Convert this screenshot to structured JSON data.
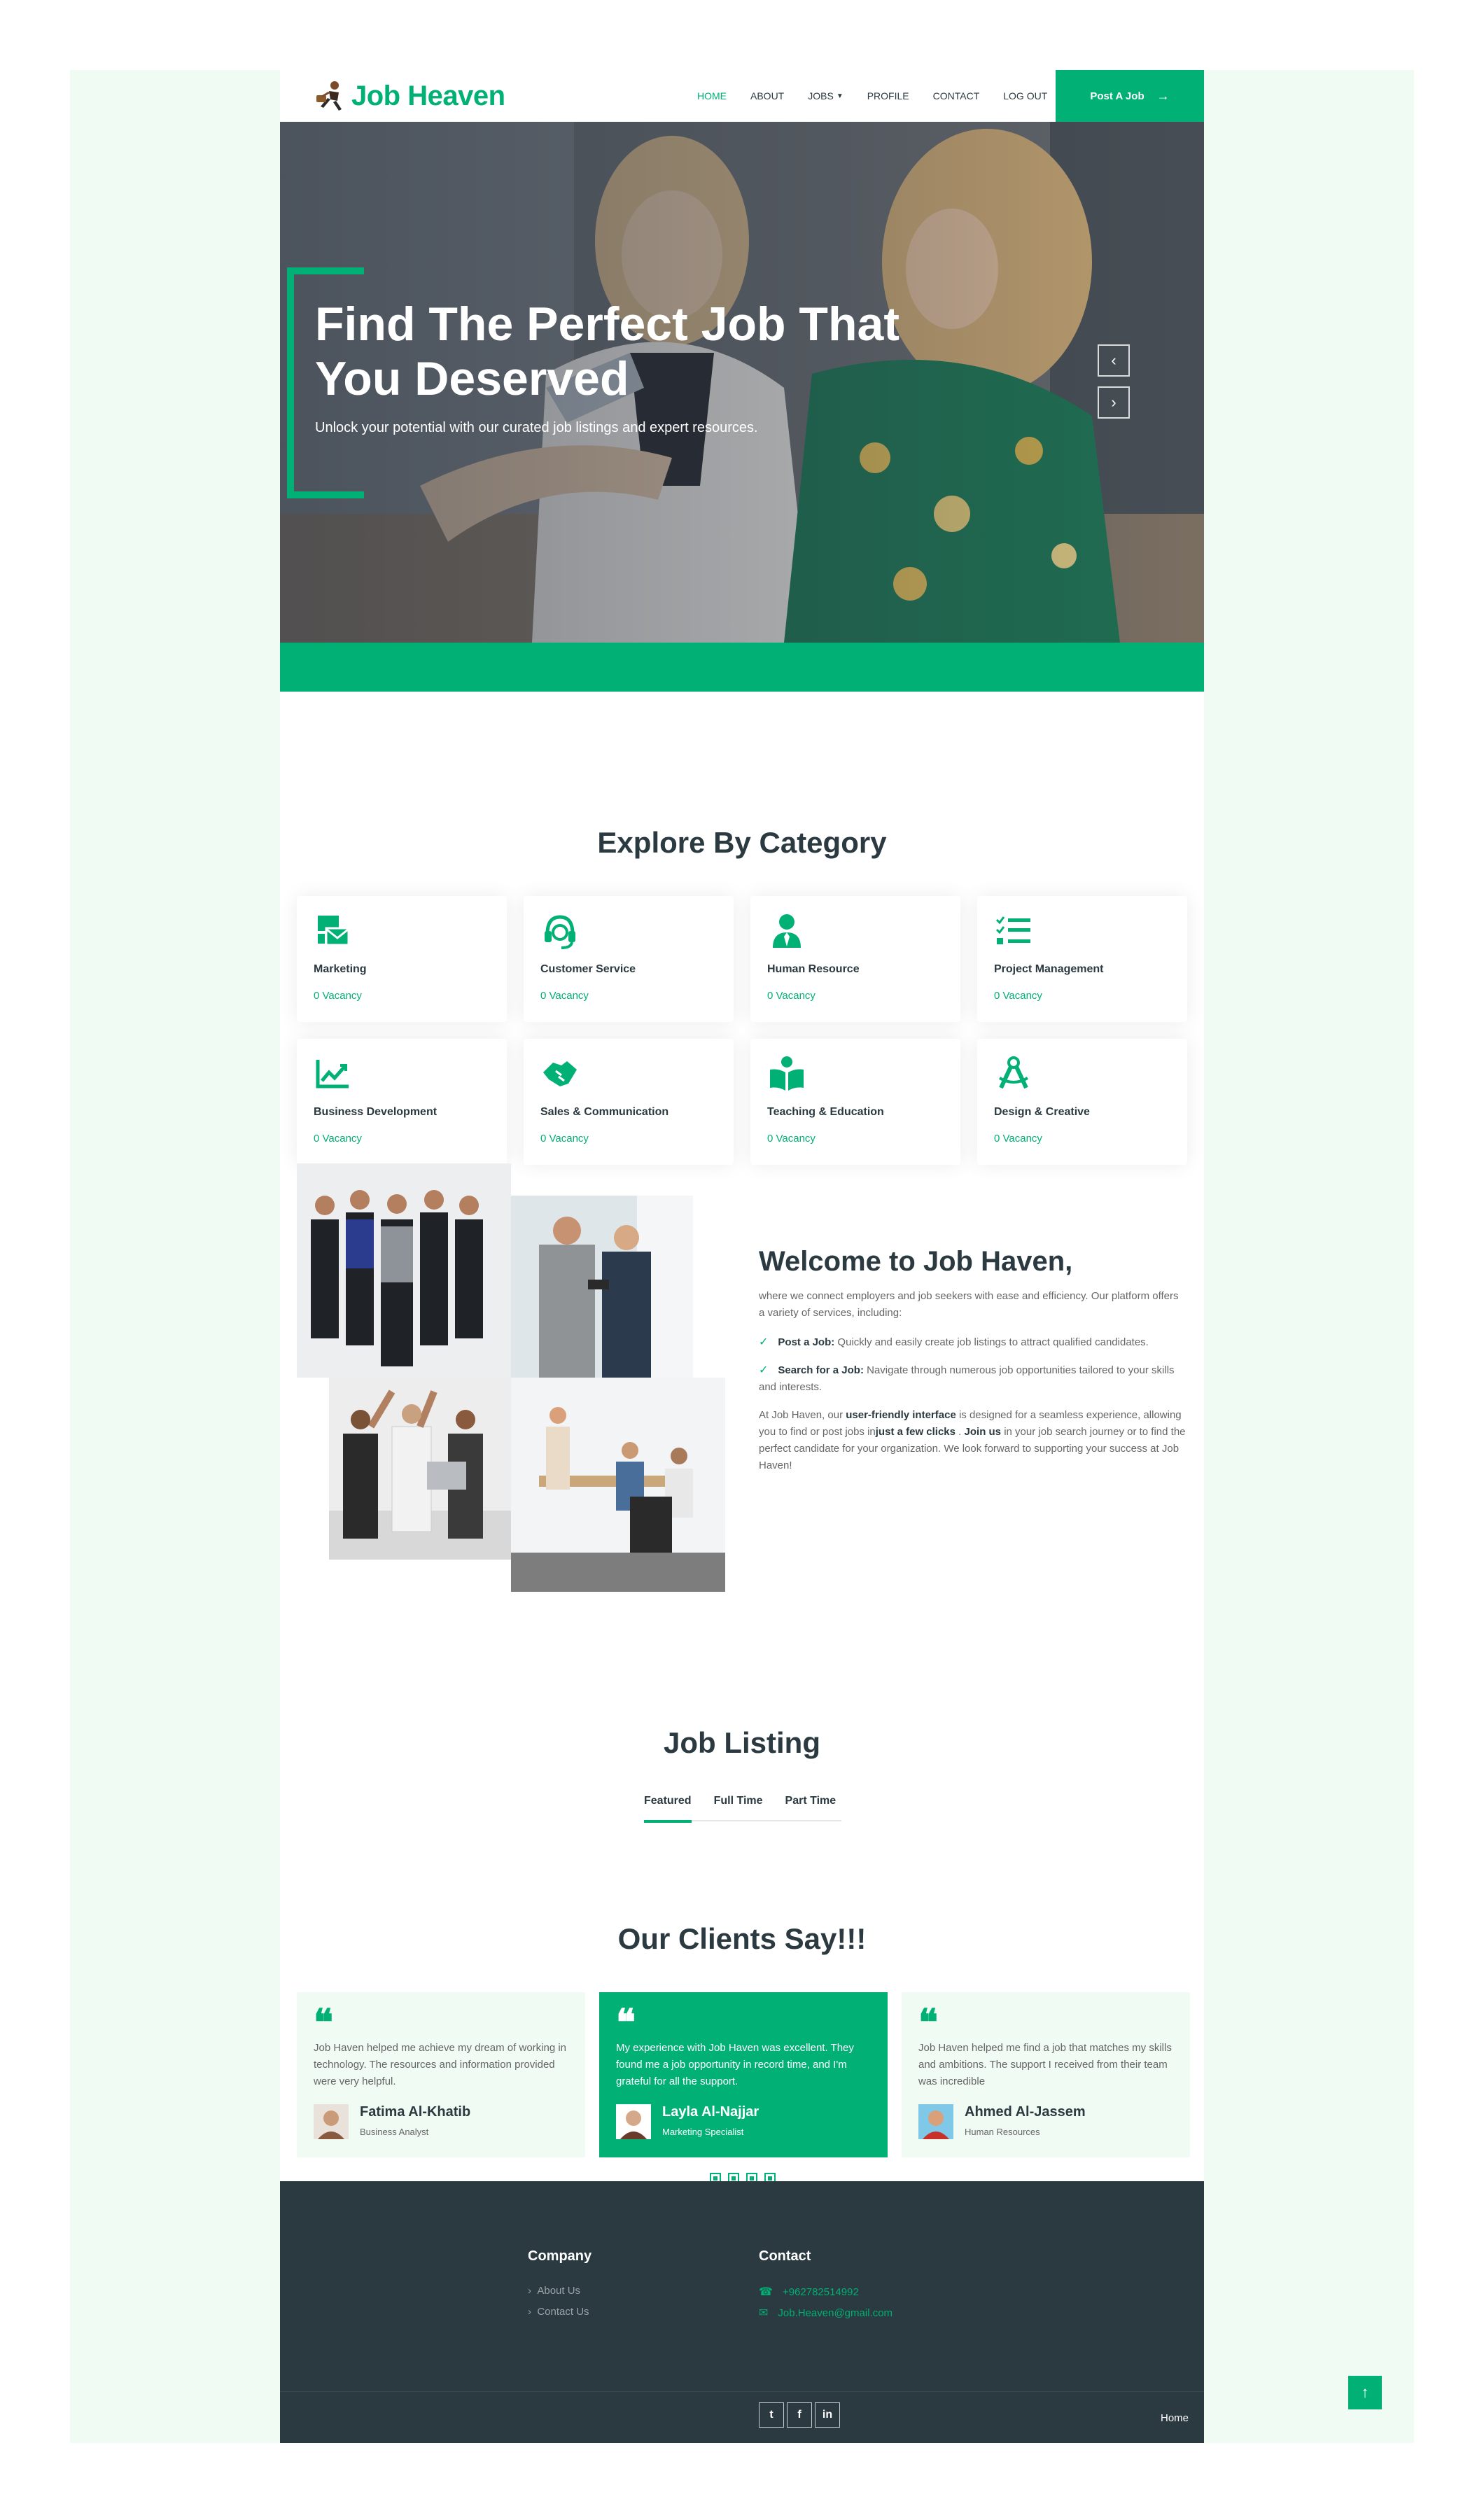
{
  "nav": {
    "brand": "Job Heaven",
    "links": [
      "HOME",
      "ABOUT",
      "JOBS",
      "PROFILE",
      "CONTACT",
      "LOG OUT"
    ],
    "cta": "Post A Job"
  },
  "hero": {
    "title": "Find The Perfect Job That You Deserved",
    "subtitle": "Unlock your potential with our curated job listings and expert resources."
  },
  "categories": {
    "title": "Explore By Category",
    "items": [
      {
        "name": "Marketing",
        "vacancy": "0 Vacancy",
        "icon": "mail-bulk-icon"
      },
      {
        "name": "Customer Service",
        "vacancy": "0 Vacancy",
        "icon": "headset-icon"
      },
      {
        "name": "Human Resource",
        "vacancy": "0 Vacancy",
        "icon": "user-tie-icon"
      },
      {
        "name": "Project Management",
        "vacancy": "0 Vacancy",
        "icon": "tasks-icon"
      },
      {
        "name": "Business Development",
        "vacancy": "0 Vacancy",
        "icon": "chart-line-icon"
      },
      {
        "name": "Sales & Communication",
        "vacancy": "0 Vacancy",
        "icon": "handshake-icon"
      },
      {
        "name": "Teaching & Education",
        "vacancy": "0 Vacancy",
        "icon": "book-reader-icon"
      },
      {
        "name": "Design & Creative",
        "vacancy": "0 Vacancy",
        "icon": "drafting-compass-icon"
      }
    ]
  },
  "about": {
    "title": "Welcome to Job Haven,",
    "intro": "where we connect employers and job seekers with ease and efficiency. Our platform offers a variety of services, including:",
    "bullets": [
      {
        "label": "Post a Job:",
        "text": " Quickly and easily create job listings to attract qualified candidates."
      },
      {
        "label": "Search for a Job:",
        "text": " Navigate through numerous job opportunities tailored to your skills and interests."
      }
    ],
    "closing": {
      "p1": "At Job Haven, our ",
      "b1": "user-friendly interface",
      "p2": " is designed for a seamless experience, allowing you to find or post jobs in",
      "b2": "just a few clicks",
      "p3": " . ",
      "b3": "Join us",
      "p4": " in your job search journey or to find the perfect candidate for your organization. We look forward to supporting your success at Job Haven!"
    }
  },
  "jobs": {
    "title": "Job Listing",
    "tabs": [
      "Featured",
      "Full Time",
      "Part Time"
    ]
  },
  "testimonials": {
    "title": "Our Clients Say!!!",
    "items": [
      {
        "text": "Job Haven helped me achieve my dream of working in technology. The resources and information provided were very helpful.",
        "name": "Fatima Al-Khatib",
        "role": "Business Analyst"
      },
      {
        "text": "My experience with Job Haven was excellent. They found me a job opportunity in record time, and I'm grateful for all the support.",
        "name": "Layla Al-Najjar",
        "role": "Marketing Specialist"
      },
      {
        "text": "Job Haven helped me find a job that matches my skills and ambitions. The support I received from their team was incredible",
        "name": "Ahmed Al-Jassem",
        "role": "Human Resources"
      }
    ]
  },
  "footer": {
    "company_title": "Company",
    "company_links": [
      "About Us",
      "Contact Us"
    ],
    "contact_title": "Contact",
    "phone": "+962782514992",
    "email": "Job.Heaven@gmail.com",
    "bottom_link": "Home"
  },
  "colors": {
    "accent": "#00b074",
    "dark": "#2b3940",
    "light_bg": "#effbf3"
  }
}
